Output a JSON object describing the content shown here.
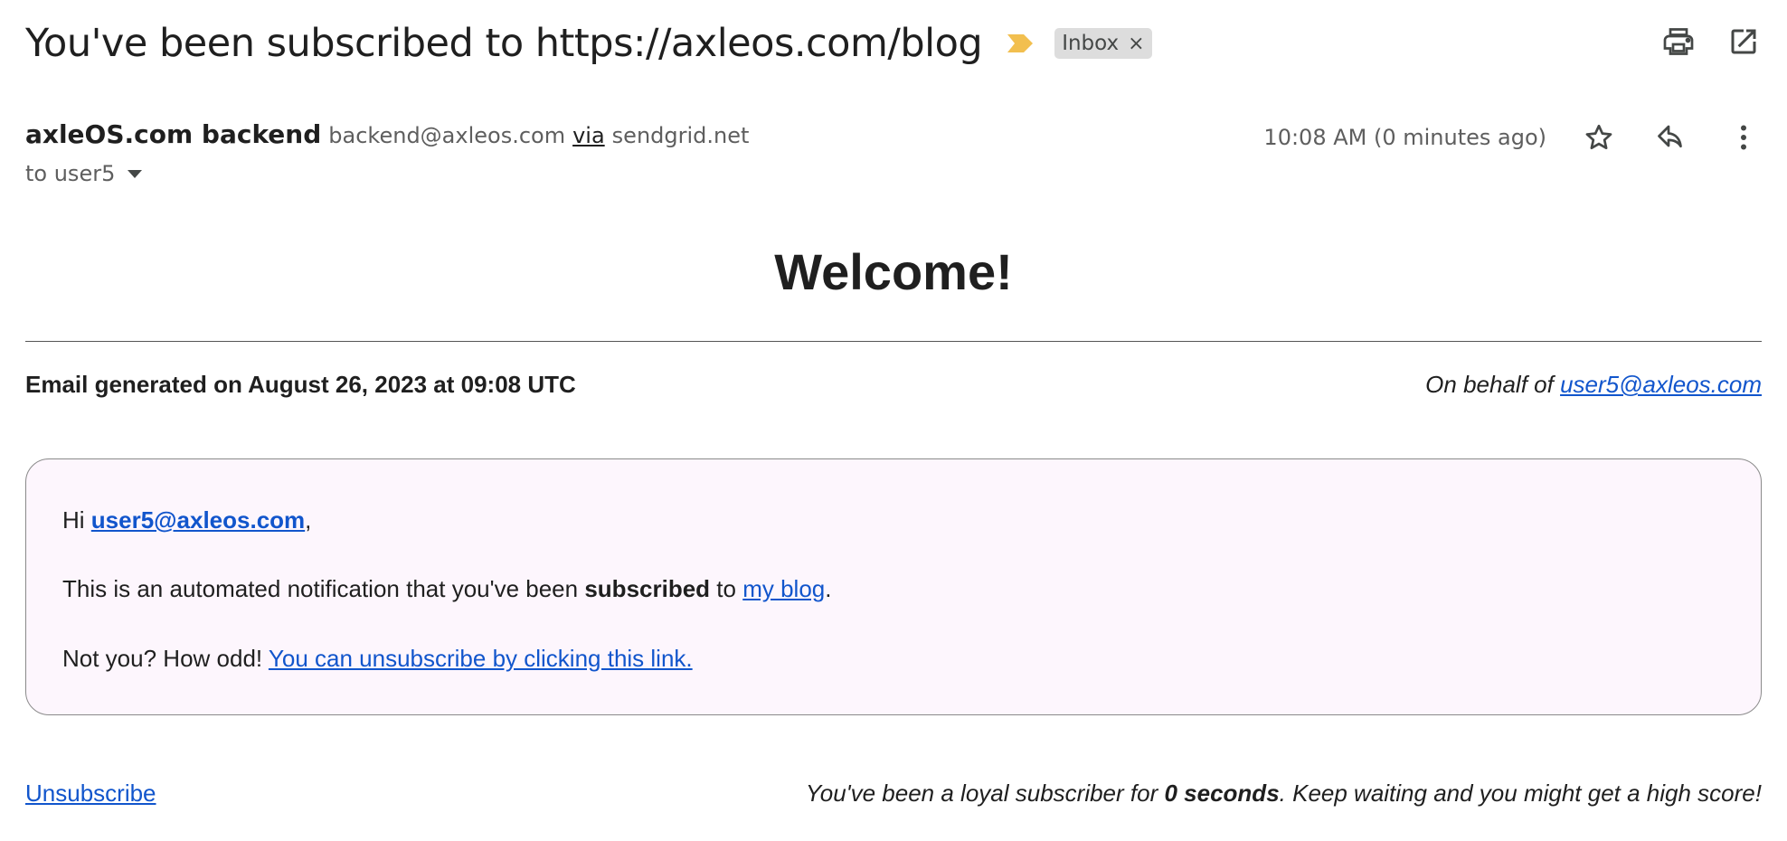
{
  "header": {
    "subject": "You've been subscribed to https://axleos.com/blog",
    "label": "Inbox",
    "label_remove": "×",
    "importance_color": "#f2bf4f",
    "actions": [
      "print-icon",
      "open-in-new-window-icon"
    ]
  },
  "sender": {
    "name": "axleOS.com backend",
    "email": "backend@axleos.com",
    "via_label": "via",
    "via_domain": "sendgrid.net",
    "to": "to user5"
  },
  "meta": {
    "timestamp": "10:08 AM (0 minutes ago)",
    "actions": [
      "star-icon",
      "reply-icon",
      "more-vert-icon"
    ]
  },
  "body": {
    "title": "Welcome!",
    "generated": "Email generated on August 26, 2023 at 09:08 UTC",
    "behalf_prefix": "On behalf of",
    "behalf_email": "user5@axleos.com",
    "card": {
      "greeting_prefix": "Hi",
      "greeting_email": "user5@axleos.com",
      "greeting_suffix": ",",
      "line2_prefix": "This is an automated notification that you've been",
      "line2_bold": "subscribed",
      "line2_mid": "to",
      "line2_link": "my blog",
      "line2_suffix": ".",
      "line3_prefix": "Not you? How odd!",
      "line3_link": "You can unsubscribe by clicking this link."
    },
    "footer": {
      "unsubscribe": "Unsubscribe",
      "loyal_prefix": "You've been a loyal subscriber for",
      "loyal_bold": "0 seconds",
      "loyal_suffix": ". Keep waiting and you might get a high score!"
    }
  },
  "colors": {
    "link": "#1155cc",
    "card_bg": "#fdf6fd",
    "chip_bg": "#dddddd"
  }
}
